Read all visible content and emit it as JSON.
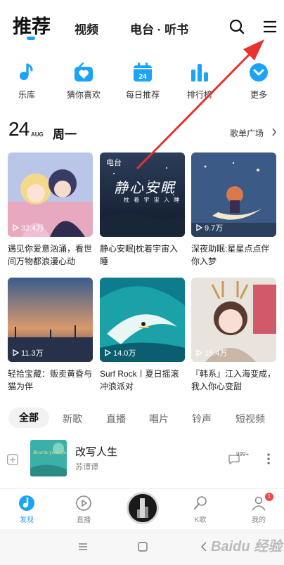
{
  "top_tabs": {
    "recommend": "推荐",
    "video": "视频",
    "radio": "电台 · 听书"
  },
  "quick_nav": [
    {
      "label": "乐库",
      "icon": "music-note-icon"
    },
    {
      "label": "猜你喜欢",
      "icon": "heart-radio-icon"
    },
    {
      "label": "每日推荐",
      "icon": "calendar-icon",
      "day": "24"
    },
    {
      "label": "排行榜",
      "icon": "chart-bars-icon"
    },
    {
      "label": "更多",
      "icon": "chevron-down-icon"
    }
  ],
  "date": {
    "day": "24",
    "month": "AUG",
    "weekday": "周一",
    "playlist_plaza": "歌单广场"
  },
  "cards": [
    {
      "title": "遇见你爱意汹涌，看世间万物都浪漫心动",
      "plays": "32.4万"
    },
    {
      "title": "静心安眠|枕着宇宙入睡",
      "tag": "电台",
      "cover_text": "静心安眠",
      "cover_subtext": "枕 着 宇 宙 入 睡"
    },
    {
      "title": "深夜助眠:星星点点伴你入梦",
      "plays": "9.7万"
    },
    {
      "title": "轻拾宝藏：贩卖黄昏与猫为伴",
      "plays": "11.3万"
    },
    {
      "title": "Surf Rock丨夏日摇滚冲浪派对",
      "plays": "14.0万"
    },
    {
      "title": "『韩系』江入海变成，我入你心变甜",
      "plays": "15.4万"
    }
  ],
  "categories": [
    "全部",
    "新歌",
    "直播",
    "唱片",
    "铃声",
    "短视频"
  ],
  "song": {
    "title": "改写人生",
    "artist": "苏谭谭",
    "comments": "999+",
    "cover_text": "Rewrite your life"
  },
  "bottom_nav": [
    {
      "label": "发现",
      "icon": "discover-icon"
    },
    {
      "label": "直播",
      "icon": "live-play-icon"
    },
    {
      "label": "K歌",
      "icon": "karaoke-mic-icon"
    },
    {
      "label": "我的",
      "icon": "profile-icon"
    }
  ],
  "badge_count": "1",
  "watermark": "Baidu 经验",
  "colors": {
    "accent": "#1aa3f7",
    "arrow": "#e8322d"
  }
}
